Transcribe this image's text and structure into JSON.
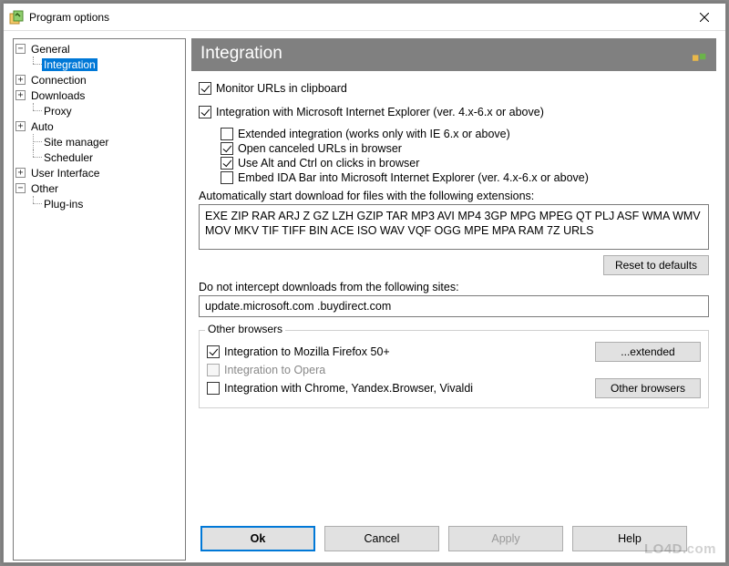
{
  "window": {
    "title": "Program options"
  },
  "tree": {
    "general": "General",
    "integration": "Integration",
    "connection": "Connection",
    "downloads": "Downloads",
    "proxy": "Proxy",
    "auto": "Auto",
    "site_manager": "Site manager",
    "scheduler": "Scheduler",
    "user_interface": "User Interface",
    "other": "Other",
    "plugins": "Plug-ins"
  },
  "header": {
    "title": "Integration"
  },
  "checks": {
    "monitor_clipboard": "Monitor URLs in clipboard",
    "ie_integration": "Integration with Microsoft Internet Explorer (ver. 4.x-6.x or above)",
    "extended_integration": "Extended integration (works only with IE 6.x or above)",
    "open_canceled": "Open canceled URLs in browser",
    "alt_ctrl": "Use Alt and Ctrl on clicks in browser",
    "embed_bar": "Embed IDA Bar into Microsoft Internet Explorer (ver. 4.x-6.x or above)"
  },
  "labels": {
    "auto_start": "Automatically start download for files with the following extensions:",
    "do_not_intercept": "Do not intercept downloads from the following sites:"
  },
  "values": {
    "extensions": "EXE ZIP RAR ARJ Z GZ LZH GZIP TAR MP3 AVI MP4 3GP MPG MPEG QT PLJ ASF WMA WMV MOV MKV TIF TIFF BIN ACE ISO WAV VQF OGG MPE MPA RAM 7Z URLS",
    "sites": "update.microsoft.com .buydirect.com"
  },
  "buttons": {
    "reset": "Reset to defaults",
    "extended": "...extended",
    "other_browsers": "Other browsers",
    "ok": "Ok",
    "cancel": "Cancel",
    "apply": "Apply",
    "help": "Help"
  },
  "group": {
    "legend": "Other browsers",
    "firefox": "Integration to Mozilla Firefox 50+",
    "opera": "Integration to Opera",
    "chrome": "Integration with Chrome, Yandex.Browser, Vivaldi"
  },
  "watermark": "LO4D.com"
}
